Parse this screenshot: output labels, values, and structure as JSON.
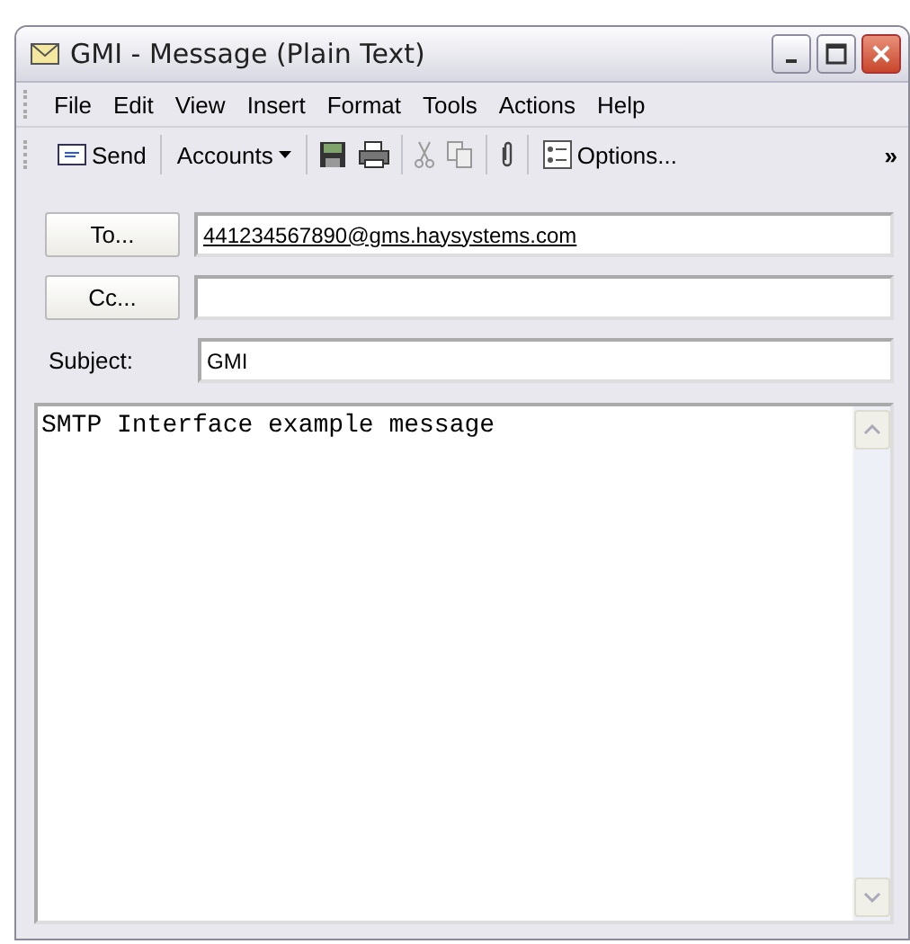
{
  "window": {
    "title": "GMI - Message (Plain Text)"
  },
  "menu": [
    "File",
    "Edit",
    "View",
    "Insert",
    "Format",
    "Tools",
    "Actions",
    "Help"
  ],
  "toolbar": {
    "send": "Send",
    "accounts": "Accounts",
    "options": "Options...",
    "overflow": "»"
  },
  "to": {
    "button": "To...",
    "value": "441234567890@gms.haysystems.com"
  },
  "cc": {
    "button": "Cc..."
  },
  "subject": {
    "label": "Subject:",
    "value": "GMI"
  },
  "body": {
    "value": "SMTP Interface example message"
  }
}
